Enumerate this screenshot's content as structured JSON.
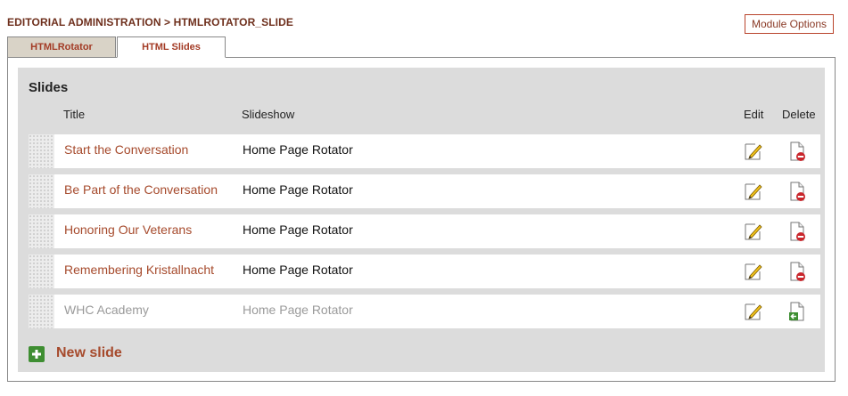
{
  "breadcrumb": "EDITORIAL ADMINISTRATION > HTMLROTATOR_SLIDE",
  "module_options_label": "Module Options",
  "tabs": [
    {
      "label": "HTMLRotator",
      "active": false
    },
    {
      "label": "HTML Slides",
      "active": true
    }
  ],
  "slides": {
    "heading": "Slides",
    "columns": {
      "title": "Title",
      "slideshow": "Slideshow",
      "edit": "Edit",
      "delete": "Delete"
    },
    "rows": [
      {
        "title": "Start the Conversation",
        "slideshow": "Home Page Rotator",
        "delete_icon": "page-delete-icon"
      },
      {
        "title": "Be Part of the Conversation",
        "slideshow": "Home Page Rotator",
        "delete_icon": "page-delete-icon"
      },
      {
        "title": "Honoring Our Veterans",
        "slideshow": "Home Page Rotator",
        "delete_icon": "page-delete-icon"
      },
      {
        "title": "Remembering Kristallnacht",
        "slideshow": "Home Page Rotator",
        "delete_icon": "page-delete-icon"
      },
      {
        "title": "WHC Academy",
        "slideshow": "Home Page Rotator",
        "delete_icon": "page-restore-icon",
        "disabled": true
      }
    ],
    "new_slide_label": "New slide"
  },
  "colors": {
    "accent": "#a64a2c",
    "breadcrumb": "#6e2f1c",
    "panel_bg": "#dcdcdc",
    "add_green": "#3e8e32",
    "disabled_text": "#9a9a9a"
  }
}
